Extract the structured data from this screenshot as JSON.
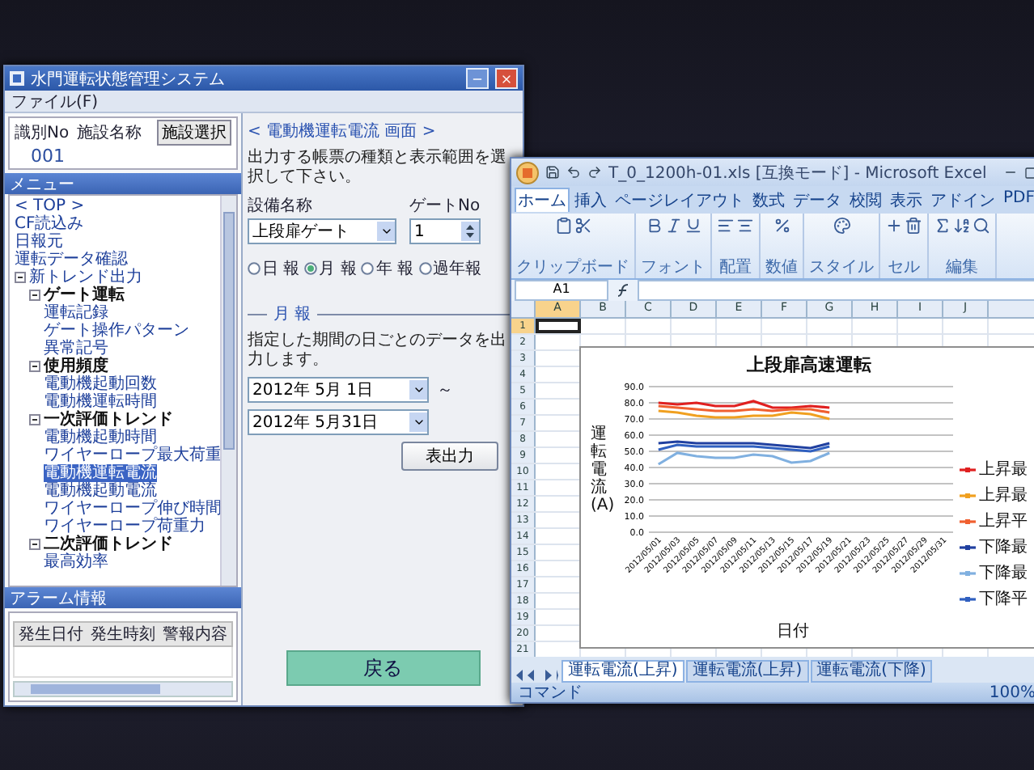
{
  "control_app": {
    "title": "水門運転状態管理システム",
    "menu": [
      "ファイル(F)"
    ],
    "facility": {
      "columns": [
        "識別No",
        "施設名称"
      ],
      "select_button": "施設選択",
      "id": "001"
    },
    "menu_header": "メニュー",
    "tree": [
      {
        "label": "< TOP >",
        "selected": false
      },
      {
        "label": "CF読込み",
        "selected": false
      },
      {
        "label": "日報元",
        "selected": false
      },
      {
        "label": "運転データ確認",
        "selected": false
      },
      {
        "label": "新トレンド出力",
        "selected": false,
        "expanded": true,
        "children": [
          {
            "label": "ゲート運転",
            "selected": false,
            "expanded": true,
            "children": [
              {
                "label": "運転記録",
                "selected": false
              },
              {
                "label": "ゲート操作パターン",
                "selected": false
              },
              {
                "label": "異常記号",
                "selected": false
              }
            ]
          },
          {
            "label": "使用頻度",
            "selected": false,
            "expanded": true,
            "children": [
              {
                "label": "電動機起動回数",
                "selected": false
              },
              {
                "label": "電動機運転時間",
                "selected": false
              }
            ]
          },
          {
            "label": "一次評価トレンド",
            "selected": false,
            "expanded": true,
            "children": [
              {
                "label": "電動機起動時間",
                "selected": false
              },
              {
                "label": "ワイヤーロープ最大荷重",
                "selected": false
              },
              {
                "label": "電動機運転電流",
                "selected": true
              },
              {
                "label": "電動機起動電流",
                "selected": false
              },
              {
                "label": "ワイヤーロープ伸び時間",
                "selected": false
              },
              {
                "label": "ワイヤーロープ荷重力",
                "selected": false
              }
            ]
          },
          {
            "label": "二次評価トレンド",
            "selected": false,
            "expanded": true,
            "children": [
              {
                "label": "最高効率",
                "selected": false
              }
            ]
          }
        ]
      }
    ],
    "alarm": {
      "header": "アラーム情報",
      "columns": [
        "発生日付",
        "発生時刻",
        "警報内容"
      ]
    },
    "screen_title": "< 電動機運転電流 画面 >",
    "instruction": "出力する帳票の種類と表示範囲を選択して下さい。",
    "equipment": {
      "label": "設備名称",
      "value": "上段扉ゲート"
    },
    "gate_no": {
      "label": "ゲートNo",
      "value": "1"
    },
    "report_types": [
      {
        "label": "日 報",
        "selected": false
      },
      {
        "label": "月 報",
        "selected": true
      },
      {
        "label": "年 報",
        "selected": false
      },
      {
        "label": "過年報",
        "selected": false
      }
    ],
    "section_title": "月 報",
    "section_note": "指定した期間の日ごとのデータを出力します。",
    "date_from": "2012年 5月 1日",
    "range_sign": "～",
    "date_to": "2012年 5月31日",
    "output_button": "表出力",
    "back_button": "戻る"
  },
  "excel": {
    "title": "T_0_1200h-01.xls [互換モード] - Microsoft Excel",
    "tabs": [
      {
        "label": "ホーム",
        "selected": true
      },
      {
        "label": "挿入",
        "selected": false
      },
      {
        "label": "ページレイアウト",
        "selected": false
      },
      {
        "label": "数式",
        "selected": false
      },
      {
        "label": "データ",
        "selected": false
      },
      {
        "label": "校閲",
        "selected": false
      },
      {
        "label": "表示",
        "selected": false
      },
      {
        "label": "アドイン",
        "selected": false
      },
      {
        "label": "PDF",
        "selected": false
      }
    ],
    "ribbon_groups": [
      "クリップボード",
      "フォント",
      "配置",
      "数値",
      "スタイル",
      "セル",
      "編集"
    ],
    "name_box": "A1",
    "columns": [
      {
        "label": "A",
        "selected": true
      },
      {
        "label": "B",
        "selected": false
      },
      {
        "label": "C",
        "selected": false
      },
      {
        "label": "D",
        "selected": false
      },
      {
        "label": "E",
        "selected": false
      },
      {
        "label": "F",
        "selected": false
      },
      {
        "label": "G",
        "selected": false
      },
      {
        "label": "H",
        "selected": false
      },
      {
        "label": "I",
        "selected": false
      },
      {
        "label": "J",
        "selected": false
      }
    ],
    "rows": [
      {
        "label": "1",
        "selected": true
      },
      {
        "label": "2",
        "selected": false
      },
      {
        "label": "3",
        "selected": false
      },
      {
        "label": "4",
        "selected": false
      },
      {
        "label": "5",
        "selected": false
      },
      {
        "label": "6",
        "selected": false
      },
      {
        "label": "7",
        "selected": false
      },
      {
        "label": "8",
        "selected": false
      },
      {
        "label": "9",
        "selected": false
      },
      {
        "label": "10",
        "selected": false
      },
      {
        "label": "11",
        "selected": false
      },
      {
        "label": "12",
        "selected": false
      },
      {
        "label": "13",
        "selected": false
      },
      {
        "label": "14",
        "selected": false
      },
      {
        "label": "15",
        "selected": false
      },
      {
        "label": "16",
        "selected": false
      },
      {
        "label": "17",
        "selected": false
      },
      {
        "label": "18",
        "selected": false
      },
      {
        "label": "19",
        "selected": false
      },
      {
        "label": "20",
        "selected": false
      },
      {
        "label": "21",
        "selected": false
      }
    ],
    "chart_data": {
      "type": "line",
      "title": "上段扉高速運転",
      "xlabel": "日付",
      "ylabel": "運転電流(A)",
      "categories": [
        "2012/05/01",
        "2012/05/03",
        "2012/05/05",
        "2012/05/07",
        "2012/05/09",
        "2012/05/11",
        "2012/05/13",
        "2012/05/15",
        "2012/05/17",
        "2012/05/19",
        "2012/05/21",
        "2012/05/23",
        "2012/05/25",
        "2012/05/27",
        "2012/05/29",
        "2012/05/31"
      ],
      "ylim": [
        0,
        90
      ],
      "grid": true,
      "legend": true,
      "yticks": [
        {
          "value": 0,
          "label": "0.0"
        },
        {
          "value": 10,
          "label": "10.0"
        },
        {
          "value": 20,
          "label": "20.0"
        },
        {
          "value": 30,
          "label": "30.0"
        },
        {
          "value": 40,
          "label": "40.0"
        },
        {
          "value": 50,
          "label": "50.0"
        },
        {
          "value": 60,
          "label": "60.0"
        },
        {
          "value": 70,
          "label": "70.0"
        },
        {
          "value": 80,
          "label": "80.0"
        },
        {
          "value": 90,
          "label": "90.0"
        }
      ],
      "series": [
        {
          "name": "上昇最",
          "color": "#e02020",
          "values": [
            80,
            79,
            80,
            78,
            78,
            81,
            77,
            77,
            78,
            77,
            null,
            null,
            null,
            null,
            null,
            null
          ]
        },
        {
          "name": "上昇最",
          "color": "#f0a020",
          "values": [
            75,
            74,
            72,
            71,
            71,
            72,
            72,
            74,
            73,
            70,
            null,
            null,
            null,
            null,
            null,
            null
          ]
        },
        {
          "name": "上昇平",
          "color": "#f06030",
          "values": [
            78,
            77,
            76,
            75,
            75,
            76,
            75,
            76,
            76,
            74,
            null,
            null,
            null,
            null,
            null,
            null
          ]
        },
        {
          "name": "下降最",
          "color": "#2040a0",
          "values": [
            55,
            56,
            55,
            55,
            55,
            55,
            54,
            53,
            52,
            55,
            null,
            null,
            null,
            null,
            null,
            null
          ]
        },
        {
          "name": "下降最",
          "color": "#80b0e0",
          "values": [
            42,
            49,
            47,
            46,
            46,
            48,
            47,
            43,
            44,
            49,
            null,
            null,
            null,
            null,
            null,
            null
          ]
        },
        {
          "name": "下降平",
          "color": "#3060c0",
          "values": [
            51,
            54,
            53,
            53,
            53,
            53,
            52,
            51,
            50,
            53,
            null,
            null,
            null,
            null,
            null,
            null
          ]
        }
      ]
    },
    "sheet_tabs": [
      {
        "label": "運転電流(上昇)",
        "selected": true
      },
      {
        "label": "運転電流(上昇)",
        "selected": false
      },
      {
        "label": "運転電流(下降)",
        "selected": false
      }
    ],
    "status": "コマンド",
    "zoom": "100%"
  }
}
